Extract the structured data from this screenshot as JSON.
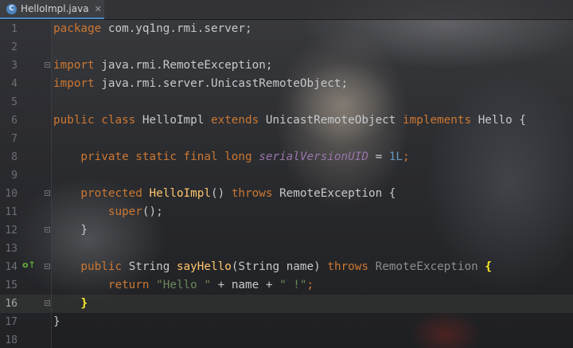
{
  "editor": {
    "tab": {
      "icon": "java-class-icon",
      "icon_letter": "C",
      "label": "HelloImpl.java"
    },
    "current_line": 16
  },
  "lines": [
    {
      "n": "1",
      "tokens": [
        {
          "t": "package",
          "c": "kw"
        },
        {
          "t": " com.yq1ng.rmi.server;",
          "c": ""
        }
      ]
    },
    {
      "n": "2",
      "tokens": []
    },
    {
      "n": "3",
      "tokens": [
        {
          "t": "import",
          "c": "kw"
        },
        {
          "t": " java.rmi.RemoteException;",
          "c": ""
        }
      ]
    },
    {
      "n": "4",
      "tokens": [
        {
          "t": "import",
          "c": "kw"
        },
        {
          "t": " java.rmi.server.UnicastRemoteObject;",
          "c": ""
        }
      ]
    },
    {
      "n": "5",
      "tokens": []
    },
    {
      "n": "6",
      "tokens": [
        {
          "t": "public class ",
          "c": "kw"
        },
        {
          "t": "HelloImpl ",
          "c": ""
        },
        {
          "t": "extends ",
          "c": "kw"
        },
        {
          "t": "UnicastRemoteObject ",
          "c": ""
        },
        {
          "t": "implements ",
          "c": "kw"
        },
        {
          "t": "Hello {",
          "c": ""
        }
      ]
    },
    {
      "n": "7",
      "tokens": []
    },
    {
      "n": "8",
      "tokens": [
        {
          "t": "    private static final long ",
          "c": "kw"
        },
        {
          "t": "serialVersionUID",
          "c": "field"
        },
        {
          "t": " = ",
          "c": ""
        },
        {
          "t": "1L",
          "c": "num"
        },
        {
          "t": ";",
          "c": "kw"
        }
      ]
    },
    {
      "n": "9",
      "tokens": []
    },
    {
      "n": "10",
      "tokens": [
        {
          "t": "    protected ",
          "c": "kw"
        },
        {
          "t": "HelloImpl",
          "c": "fn"
        },
        {
          "t": "() ",
          "c": ""
        },
        {
          "t": "throws ",
          "c": "kw"
        },
        {
          "t": "RemoteException {",
          "c": ""
        }
      ]
    },
    {
      "n": "11",
      "tokens": [
        {
          "t": "        super",
          "c": "kw"
        },
        {
          "t": "();",
          "c": ""
        }
      ]
    },
    {
      "n": "12",
      "tokens": [
        {
          "t": "    }",
          "c": ""
        }
      ]
    },
    {
      "n": "13",
      "tokens": []
    },
    {
      "n": "14",
      "tokens": [
        {
          "t": "    public ",
          "c": "kw"
        },
        {
          "t": "String ",
          "c": ""
        },
        {
          "t": "sayHello",
          "c": "fn"
        },
        {
          "t": "(String name) ",
          "c": ""
        },
        {
          "t": "throws ",
          "c": "kw"
        },
        {
          "t": "RemoteException ",
          "c": "dim"
        },
        {
          "t": "{",
          "c": "brace-hl"
        }
      ]
    },
    {
      "n": "15",
      "tokens": [
        {
          "t": "        return ",
          "c": "kw"
        },
        {
          "t": "\"Hello \"",
          "c": "str"
        },
        {
          "t": " + name + ",
          "c": ""
        },
        {
          "t": "\" !\"",
          "c": "str"
        },
        {
          "t": ";",
          "c": "kw"
        }
      ]
    },
    {
      "n": "16",
      "tokens": [
        {
          "t": "    ",
          "c": ""
        },
        {
          "t": "}",
          "c": "brace-hl"
        }
      ]
    },
    {
      "n": "17",
      "tokens": [
        {
          "t": "}",
          "c": ""
        }
      ]
    },
    {
      "n": "18",
      "tokens": []
    }
  ],
  "gutter_marks": {
    "override_line": "14",
    "override_icon": "override-method-icon",
    "override_text": "o↑"
  },
  "fold_lines": [
    "3",
    "10",
    "12",
    "14",
    "16"
  ]
}
